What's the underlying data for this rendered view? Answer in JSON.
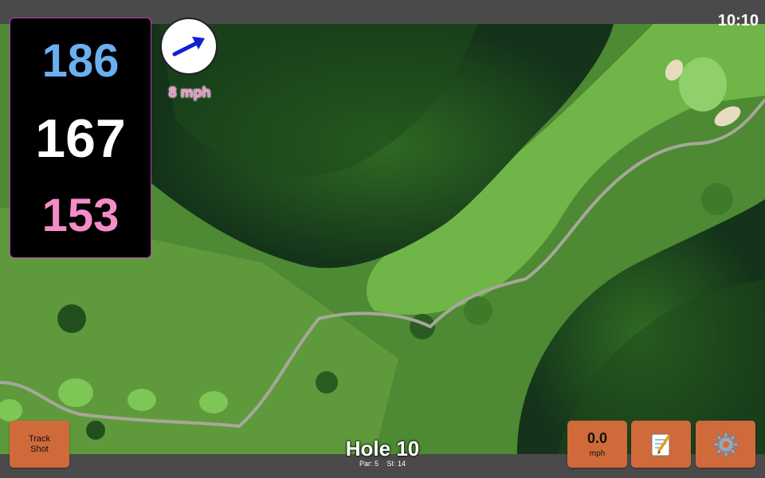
{
  "status": {
    "time": "10:10"
  },
  "distances": {
    "back": "186",
    "middle": "167",
    "front": "153"
  },
  "wind": {
    "speed_label": "8 mph",
    "direction_icon": "wind-arrow-icon"
  },
  "hole": {
    "title": "Hole 10",
    "par": "Par: 5",
    "stroke_index": "SI: 14"
  },
  "buttons": {
    "track_shot_line1": "Track",
    "track_shot_line2": "Shot",
    "speed_value": "0.0",
    "speed_unit": "mph",
    "notes_icon": "notepad-icon",
    "settings_icon": "gear-icon"
  },
  "colors": {
    "back_distance": "#6ab0f0",
    "middle_distance": "#ffffff",
    "front_distance": "#f48cc8",
    "button_bg": "#d06a3a",
    "wind_arrow": "#1020d0"
  }
}
